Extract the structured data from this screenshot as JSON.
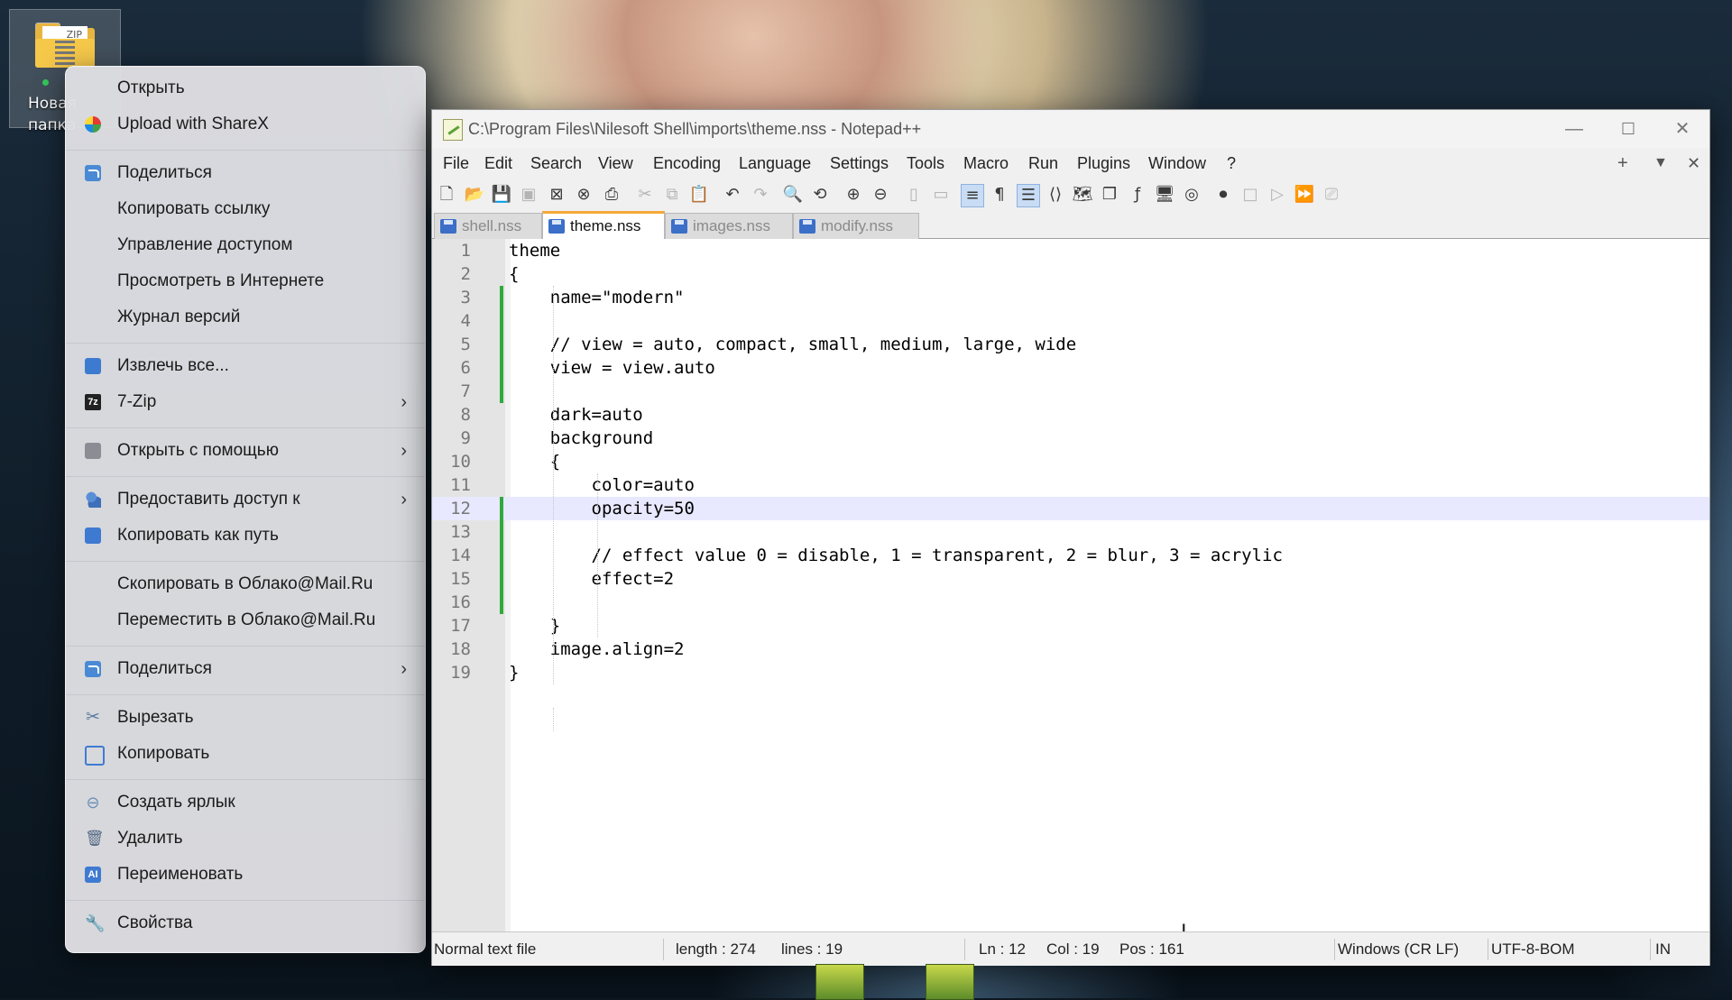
{
  "desktop": {
    "icon_label": "Новая папка"
  },
  "context_menu": {
    "items": [
      {
        "label": "Открыть",
        "icon": "none"
      },
      {
        "label": "Upload with ShareX",
        "icon": "sharex-icon"
      },
      {
        "label": "Поделиться",
        "icon": "share-icon"
      },
      {
        "label": "Копировать ссылку",
        "icon": "none"
      },
      {
        "label": "Управление доступом",
        "icon": "none"
      },
      {
        "label": "Просмотреть в Интернете",
        "icon": "none"
      },
      {
        "label": "Журнал версий",
        "icon": "none"
      },
      {
        "label": "Извлечь все...",
        "icon": "extract-icon"
      },
      {
        "label": "7-Zip",
        "icon": "7zip-icon",
        "submenu": true
      },
      {
        "label": "Открыть с помощью",
        "icon": "open-with-icon",
        "submenu": true
      },
      {
        "label": "Предоставить доступ к",
        "icon": "give-access-icon",
        "submenu": true
      },
      {
        "label": "Копировать как путь",
        "icon": "copy-path-icon"
      },
      {
        "label": "Скопировать в Облако@Mail.Ru",
        "icon": "none"
      },
      {
        "label": "Переместить в Облако@Mail.Ru",
        "icon": "none"
      },
      {
        "label": "Поделиться",
        "icon": "share-icon",
        "submenu": true
      },
      {
        "label": "Вырезать",
        "icon": "cut-icon"
      },
      {
        "label": "Копировать",
        "icon": "copy-icon"
      },
      {
        "label": "Создать ярлык",
        "icon": "shortcut-icon"
      },
      {
        "label": "Удалить",
        "icon": "delete-icon"
      },
      {
        "label": "Переименовать",
        "icon": "rename-icon"
      },
      {
        "label": "Свойства",
        "icon": "properties-icon"
      }
    ],
    "submenu_arrow": "›",
    "sevenzip_glyph": "7z",
    "rename_glyph": "AI"
  },
  "window": {
    "title": "C:\\Program Files\\Nilesoft Shell\\imports\\theme.nss - Notepad++",
    "controls": {
      "minimize": "—",
      "maximize": "☐",
      "close": "✕"
    },
    "menu": [
      "File",
      "Edit",
      "Search",
      "View",
      "Encoding",
      "Language",
      "Settings",
      "Tools",
      "Macro",
      "Run",
      "Plugins",
      "Window",
      "?"
    ],
    "menu_right": {
      "plus": "+",
      "dropdown": "▼",
      "close": "✕"
    },
    "tabs": [
      {
        "label": "shell.nss",
        "active": false
      },
      {
        "label": "theme.nss",
        "active": true
      },
      {
        "label": "images.nss",
        "active": false
      },
      {
        "label": "modify.nss",
        "active": false
      }
    ],
    "code_lines": [
      "theme",
      "{",
      "    name=\"modern\"",
      "",
      "    // view = auto, compact, small, medium, large, wide",
      "    view = view.auto",
      "",
      "    dark=auto",
      "    background",
      "    {",
      "        color=auto",
      "        opacity=50",
      "",
      "        // effect value 0 = disable, 1 = transparent, 2 = blur, 3 = acrylic",
      "        effect=2",
      "",
      "    }",
      "    image.align=2",
      "}"
    ],
    "line_numbers": [
      "1",
      "2",
      "3",
      "4",
      "5",
      "6",
      "7",
      "8",
      "9",
      "10",
      "11",
      "12",
      "13",
      "14",
      "15",
      "16",
      "17",
      "18",
      "19"
    ],
    "current_line": 12,
    "status": {
      "file_type": "Normal text file",
      "length": "length : 274",
      "lines": "lines : 19",
      "ln": "Ln : 12",
      "col": "Col : 19",
      "pos": "Pos : 161",
      "eol": "Windows (CR LF)",
      "encoding": "UTF-8-BOM",
      "mode": "IN"
    }
  }
}
